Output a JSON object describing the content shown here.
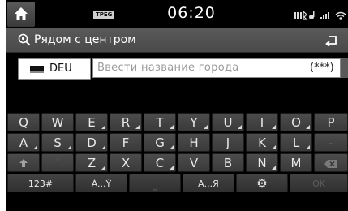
{
  "status": {
    "tpeg_label": "TPEG",
    "time": "06:20"
  },
  "header": {
    "title": "Рядом с центром"
  },
  "input": {
    "country": "DEU",
    "placeholder": "Ввести название города",
    "count": "(***)"
  },
  "keyboard": {
    "rows": [
      [
        "Q",
        "W",
        "E",
        "R",
        "T",
        "Y",
        "U",
        "I",
        "O",
        "P"
      ],
      [
        "A",
        "S",
        "D",
        "F",
        "G",
        "H",
        "J",
        "K",
        "L",
        "-"
      ],
      [
        "⇧",
        "'",
        "Z",
        "X",
        "C",
        "V",
        "B",
        "N",
        "M",
        "⌫"
      ]
    ],
    "bottom": {
      "mode_label": "123#",
      "accents_label": "Á...Ý",
      "space_label": "⎵",
      "cyrillic_label": "А...Я",
      "settings_label": "⚙",
      "ok_label": "OK"
    }
  },
  "icons": {
    "home": "home-icon",
    "search": "search-icon",
    "back": "back-icon",
    "shift": "shift-icon",
    "delete": "backspace-icon",
    "settings": "gear-icon",
    "flag": "flag-icon"
  }
}
